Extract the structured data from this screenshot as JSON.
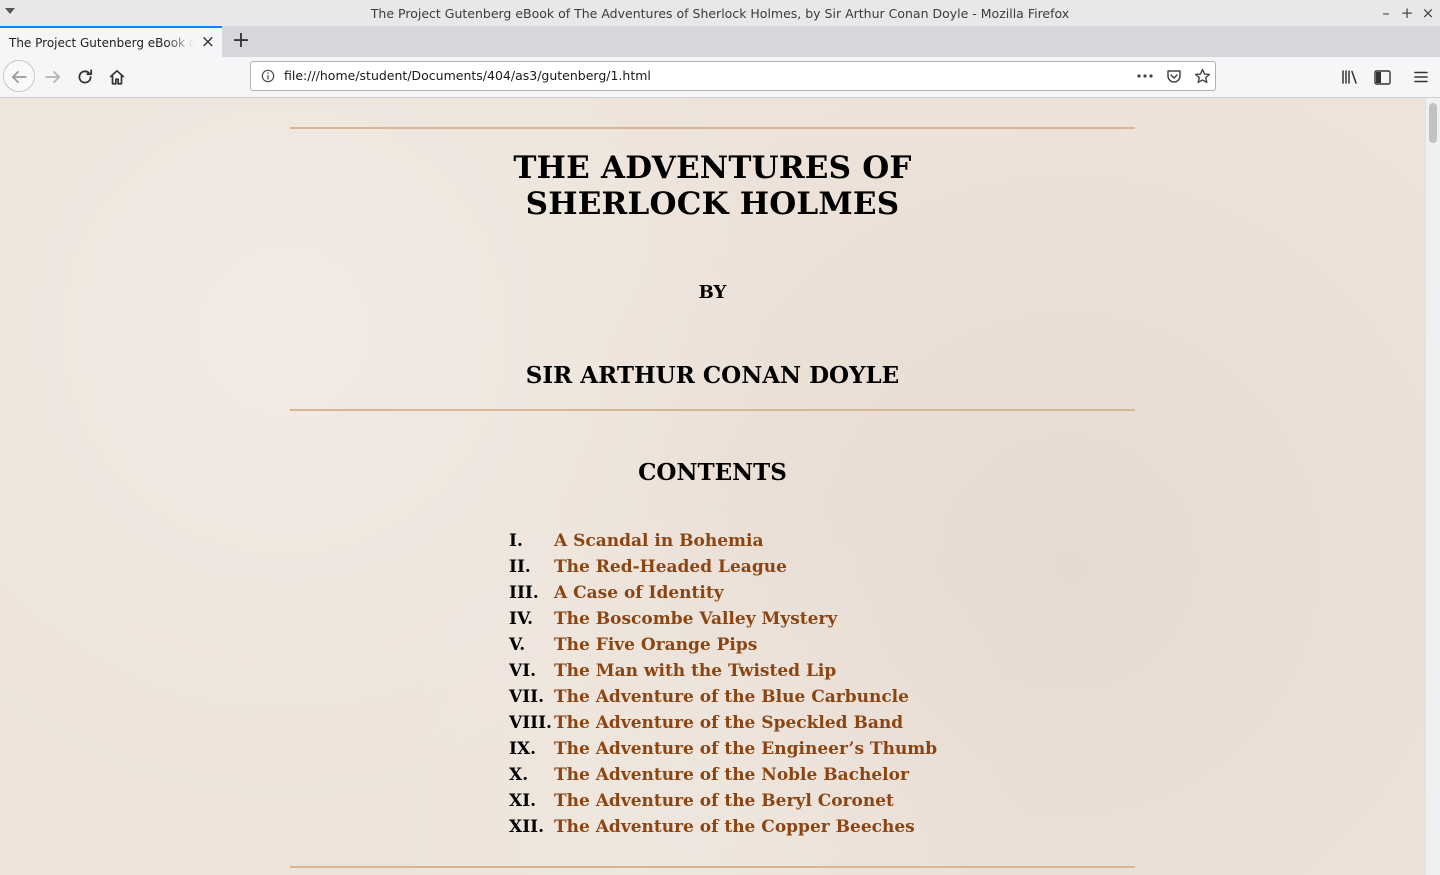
{
  "window": {
    "title": "The Project Gutenberg eBook of The Adventures of Sherlock Holmes, by Sir Arthur Conan Doyle - Mozilla Firefox",
    "controls": [
      "minimize-icon",
      "maximize-icon",
      "close-icon"
    ]
  },
  "tabs": [
    {
      "label": "The Project Gutenberg eBook of The Adventures of Sherlock Holmes",
      "active": true
    }
  ],
  "navbar": {
    "url": "file:///home/student/Documents/404/as3/gutenberg/1.html",
    "accent": "#0a84ff"
  },
  "page": {
    "title_line1": "THE ADVENTURES OF",
    "title_line2": "SHERLOCK HOLMES",
    "by": "BY",
    "author": "SIR ARTHUR CONAN DOYLE",
    "contents_heading": "CONTENTS",
    "link_color": "#8a4513",
    "rule_color": "#d6b693",
    "toc": [
      {
        "num": "I.",
        "title": "A Scandal in Bohemia"
      },
      {
        "num": "II.",
        "title": "The Red-Headed League"
      },
      {
        "num": "III.",
        "title": "A Case of Identity"
      },
      {
        "num": "IV.",
        "title": "The Boscombe Valley Mystery"
      },
      {
        "num": "V.",
        "title": "The Five Orange Pips"
      },
      {
        "num": "VI.",
        "title": "The Man with the Twisted Lip"
      },
      {
        "num": "VII.",
        "title": "The Adventure of the Blue Carbuncle"
      },
      {
        "num": "VIII.",
        "title": "The Adventure of the Speckled Band"
      },
      {
        "num": "IX.",
        "title": "The Adventure of the Engineer’s Thumb"
      },
      {
        "num": "X.",
        "title": "The Adventure of the Noble Bachelor"
      },
      {
        "num": "XI.",
        "title": "The Adventure of the Beryl Coronet"
      },
      {
        "num": "XII.",
        "title": "The Adventure of the Copper Beeches"
      }
    ]
  }
}
